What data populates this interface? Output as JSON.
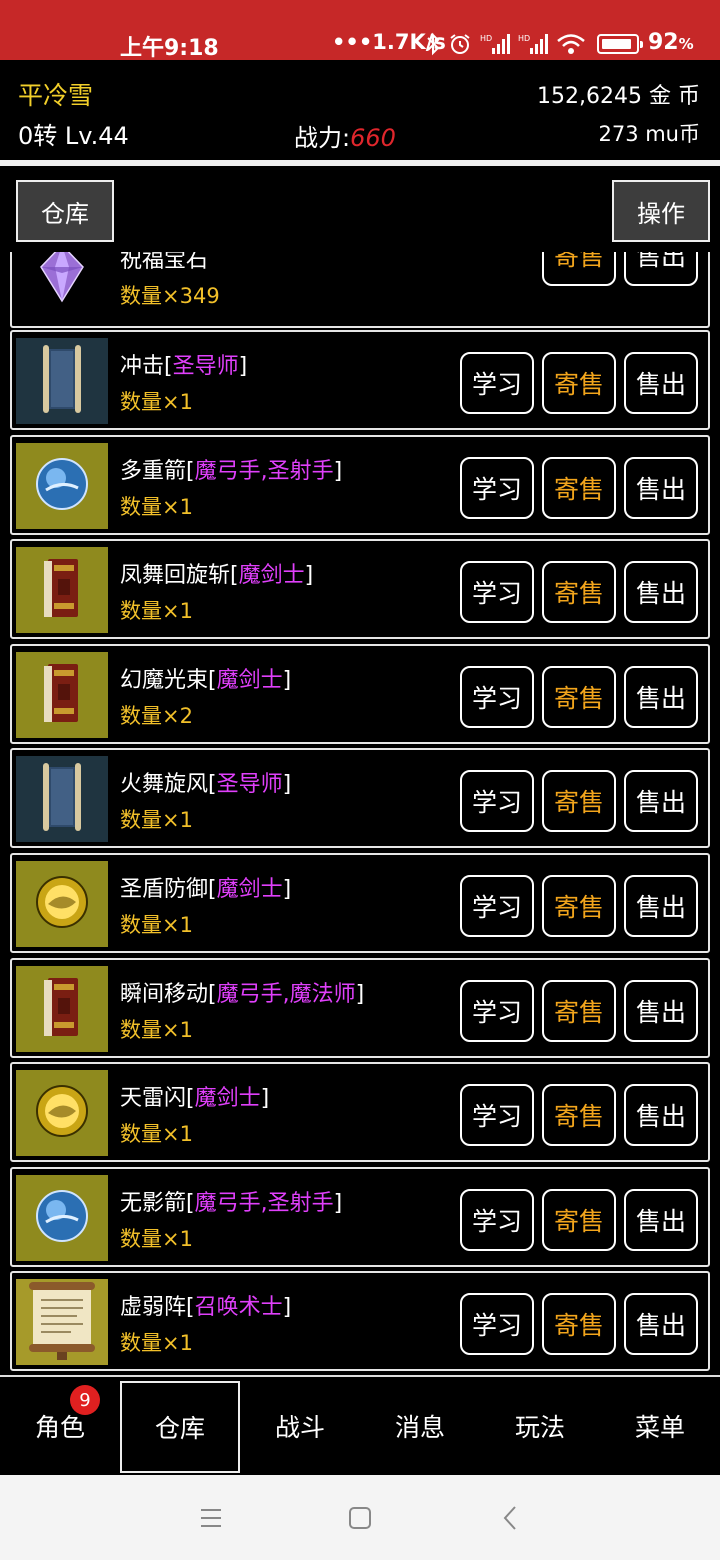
{
  "status": {
    "time": "上午9:18",
    "network_speed": "•••1.7K/s",
    "battery": "92",
    "battery_unit": "%",
    "battery_level": 0.92
  },
  "header": {
    "player_name": "平冷雪",
    "gold": "152,6245 金 币",
    "level": "0转 Lv.44",
    "power_label": "战力:",
    "power_value": "660",
    "mu": "273 mu币"
  },
  "toolbar": {
    "warehouse_label": "仓库",
    "operate_label": "操作"
  },
  "actions": {
    "learn": "学习",
    "consign": "寄售",
    "sell": "售出"
  },
  "items": [
    {
      "name": "祝福宝石",
      "class": "",
      "qty": "数量×349",
      "icon": "gem-icon",
      "partial": true
    },
    {
      "name": "冲击",
      "class": "圣导师",
      "qty": "数量×1",
      "icon": "scroll-icon"
    },
    {
      "name": "多重箭",
      "class": "魔弓手,圣射手",
      "qty": "数量×1",
      "icon": "blue-orb-icon"
    },
    {
      "name": "凤舞回旋斩",
      "class": "魔剑士",
      "qty": "数量×1",
      "icon": "book-icon"
    },
    {
      "name": "幻魔光束",
      "class": "魔剑士",
      "qty": "数量×2",
      "icon": "book-icon"
    },
    {
      "name": "火舞旋风",
      "class": "圣导师",
      "qty": "数量×1",
      "icon": "scroll-icon"
    },
    {
      "name": "圣盾防御",
      "class": "魔剑士",
      "qty": "数量×1",
      "icon": "yellow-orb-icon"
    },
    {
      "name": "瞬间移动",
      "class": "魔弓手,魔法师",
      "qty": "数量×1",
      "icon": "book-icon"
    },
    {
      "name": "天雷闪",
      "class": "魔剑士",
      "qty": "数量×1",
      "icon": "yellow-orb-icon"
    },
    {
      "name": "无影箭",
      "class": "魔弓手,圣射手",
      "qty": "数量×1",
      "icon": "blue-orb-icon"
    },
    {
      "name": "虚弱阵",
      "class": "召唤术士",
      "qty": "数量×1",
      "icon": "parchment-icon"
    }
  ],
  "nav": {
    "items": [
      "角色",
      "仓库",
      "战斗",
      "消息",
      "玩法",
      "菜单"
    ],
    "badge": "9",
    "active": "仓库"
  }
}
